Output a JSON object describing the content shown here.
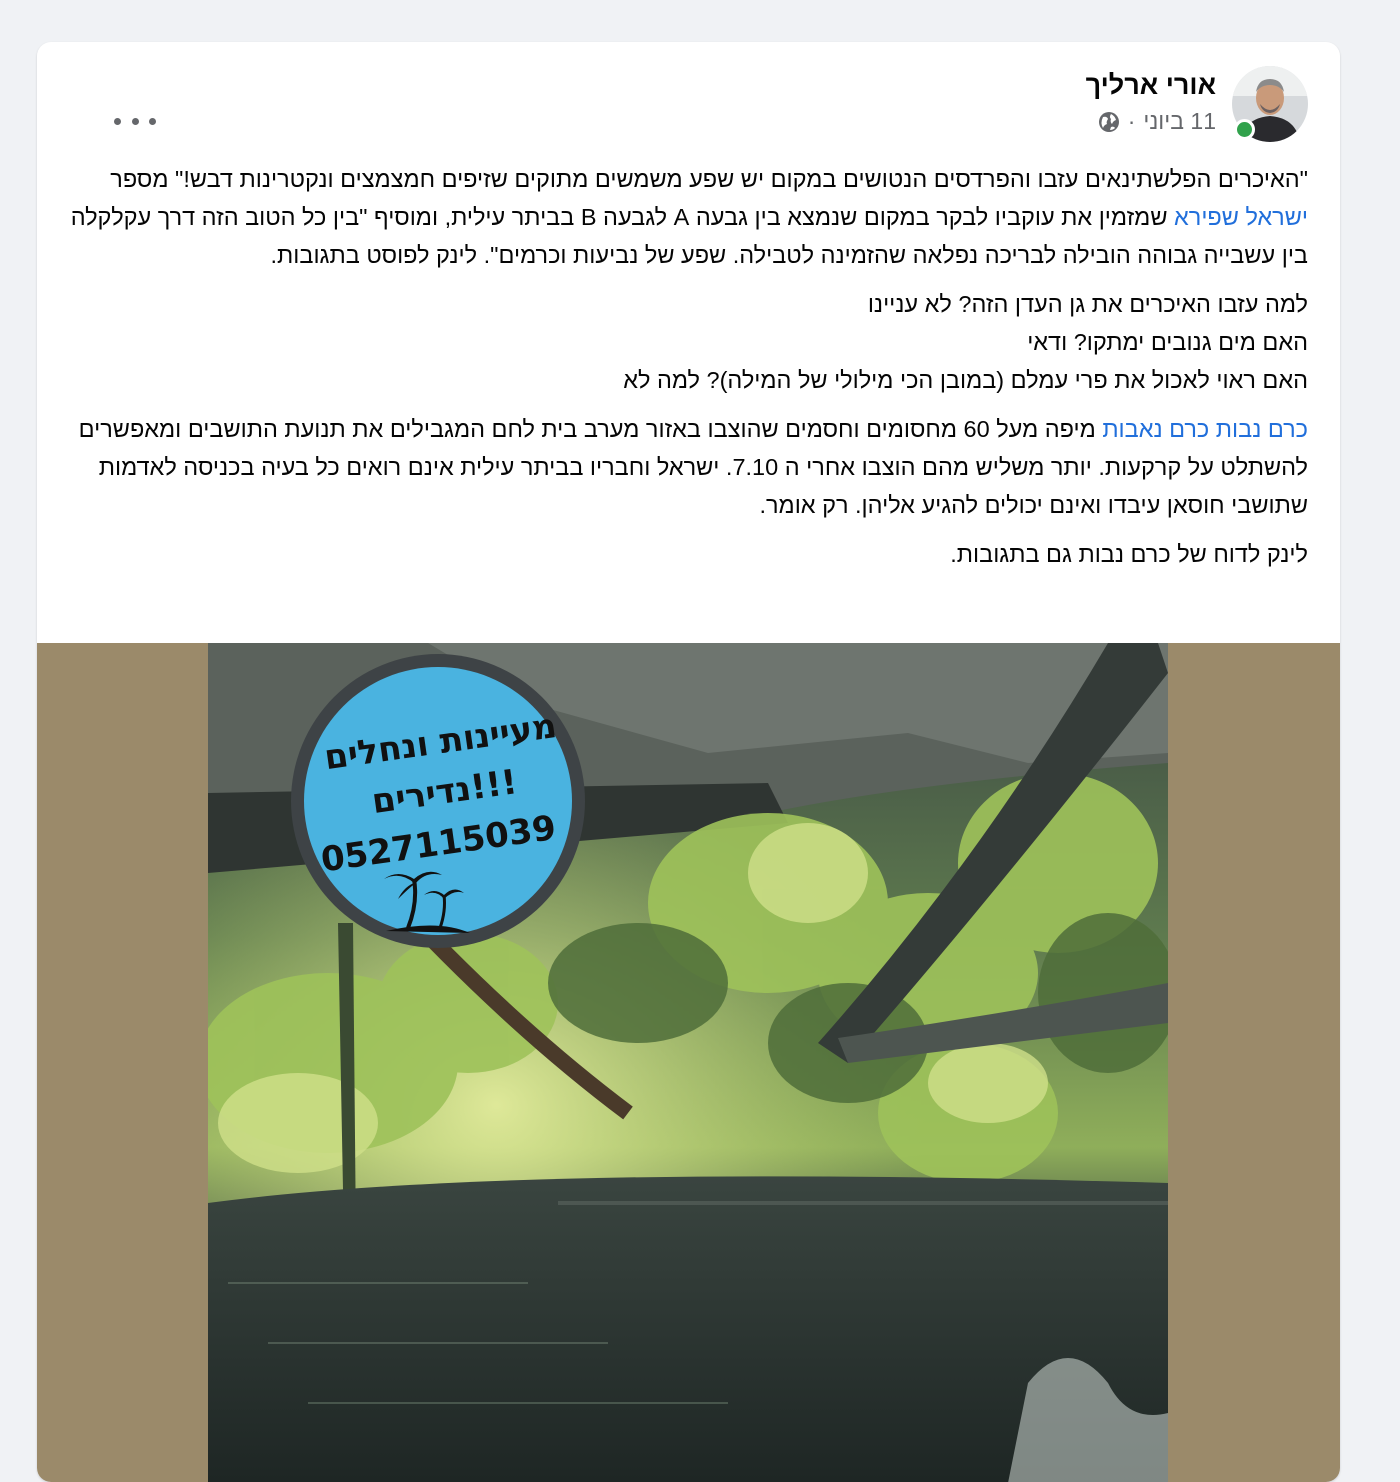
{
  "post": {
    "author_name": "אורי ארליך",
    "date": "11 ביוני",
    "separator": "·",
    "paragraph1": {
      "text_a": "\"האיכרים הפלשתינאים עזבו והפרדסים הנטושים במקום יש שפע משמשים מתוקים שזיפים חמצמצים ונקטרינות דבש!\" מספר ",
      "link": "ישראל שפירא",
      "text_b": " שמזמין את עוקביו לבקר במקום שנמצא בין גבעה A לגבעה B בביתר עילית, ומוסיף \"בין כל הטוב הזה דרך עקלקלה בין עשבייה גבוהה הובילה לבריכה נפלאה שהזמינה לטבילה. שפע של נביעות וכרמים\". לינק לפוסט בתגובות."
    },
    "paragraph2": {
      "line1": "למה עזבו האיכרים את גן העדן הזה? לא עניינו",
      "line2": "האם מים גנובים ימתקו? ודאי",
      "line3": "האם ראוי לאכול את פרי עמלם (במובן הכי מילולי של המילה)? למה לא"
    },
    "paragraph3": {
      "link": "כרם נבות כרם נאבות",
      "text": " מיפה מעל 60 מחסומים וחסמים שהוצבו באזור מערב בית לחם המגבילים את תנועת התושבים ומאפשרים להשתלט על קרקעות. יותר משליש מהם הוצבו אחרי ה 7.10. ישראל וחבריו בביתר עילית אינם רואים כל בעיה בכניסה לאדמות שתושבי חוסאן עיבדו ואינם יכולים להגיע אליהן. רק אומר."
    },
    "paragraph4": "לינק לדוח של כרם נבות גם בתגובות.",
    "media": {
      "badge_line1": "מעיינות ונחלים",
      "badge_line2": "נדירים!!!",
      "badge_line3": "0527115039"
    }
  },
  "icons": [
    "avatar",
    "globe-icon",
    "more-icon",
    "palm-tree-icon"
  ],
  "colors": {
    "link": "#216fdb",
    "text": "#050505",
    "meta": "#65676b",
    "media_background": "#9b8a6a",
    "badge": "#4ab3e0",
    "online": "#31a24c"
  }
}
